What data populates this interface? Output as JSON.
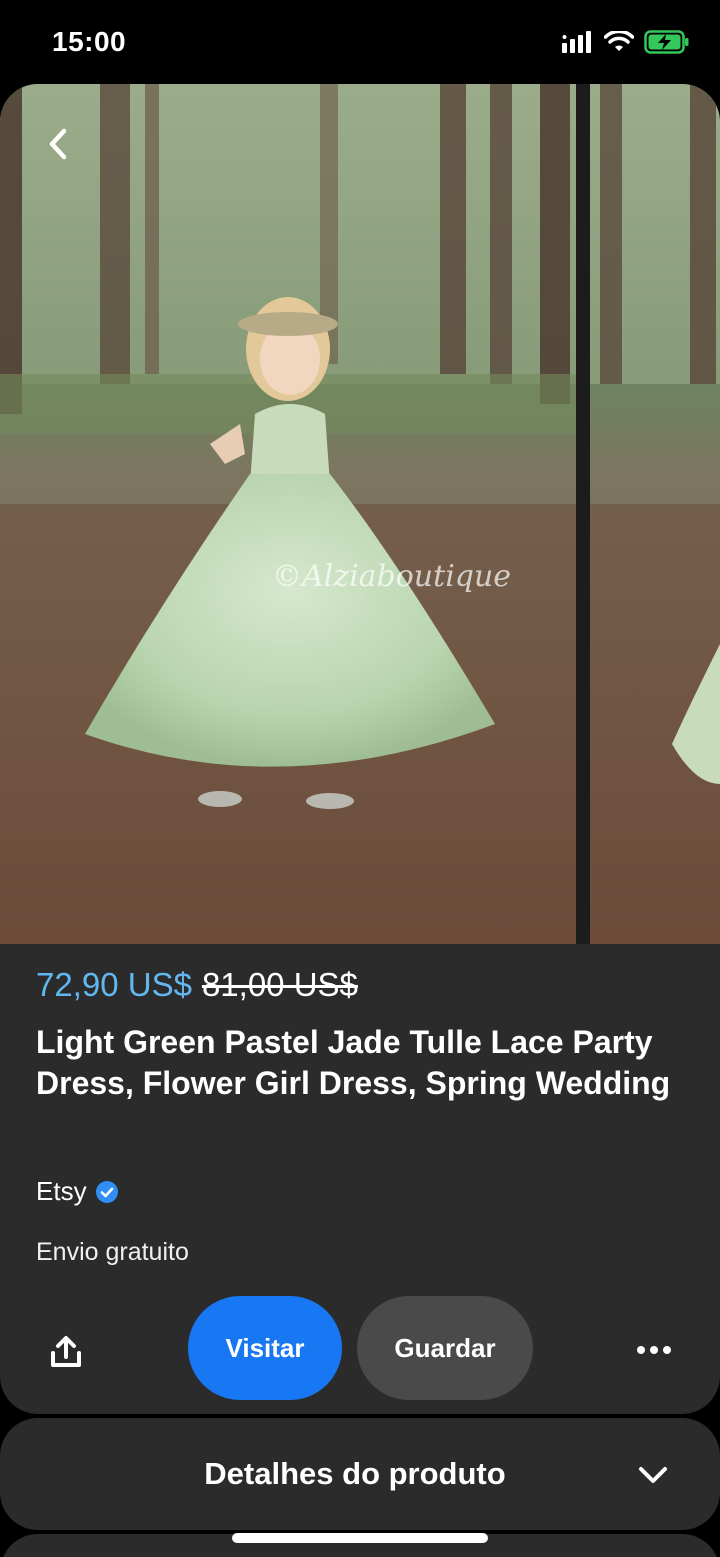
{
  "status_bar": {
    "time": "15:00",
    "icons": [
      "signal-icon",
      "wifi-icon",
      "battery-charging-icon"
    ],
    "battery_color": "#34c759"
  },
  "image": {
    "watermark": "©Alziaboutique",
    "back_icon": "chevron-left-icon"
  },
  "product": {
    "price_current": "72,90 US$",
    "price_original": "81,00 US$",
    "title": "Light Green Pastel Jade Tulle Lace Party Dress, Flower Girl Dress, Spring Wedding",
    "seller": "Etsy",
    "seller_verified_icon": "verified-badge-icon",
    "shipping": "Envio gratuito"
  },
  "actions": {
    "share_icon": "share-icon",
    "visit_label": "Visitar",
    "save_label": "Guardar",
    "more_icon": "more-horizontal-icon"
  },
  "details": {
    "label": "Detalhes do produto",
    "chevron_icon": "chevron-down-icon"
  },
  "colors": {
    "price_accent": "#62b7f0",
    "visit_button": "#1877f2",
    "save_button": "#4a4a4a",
    "panel_bg": "#2b2b2b",
    "verified_badge": "#2f8ff7"
  }
}
